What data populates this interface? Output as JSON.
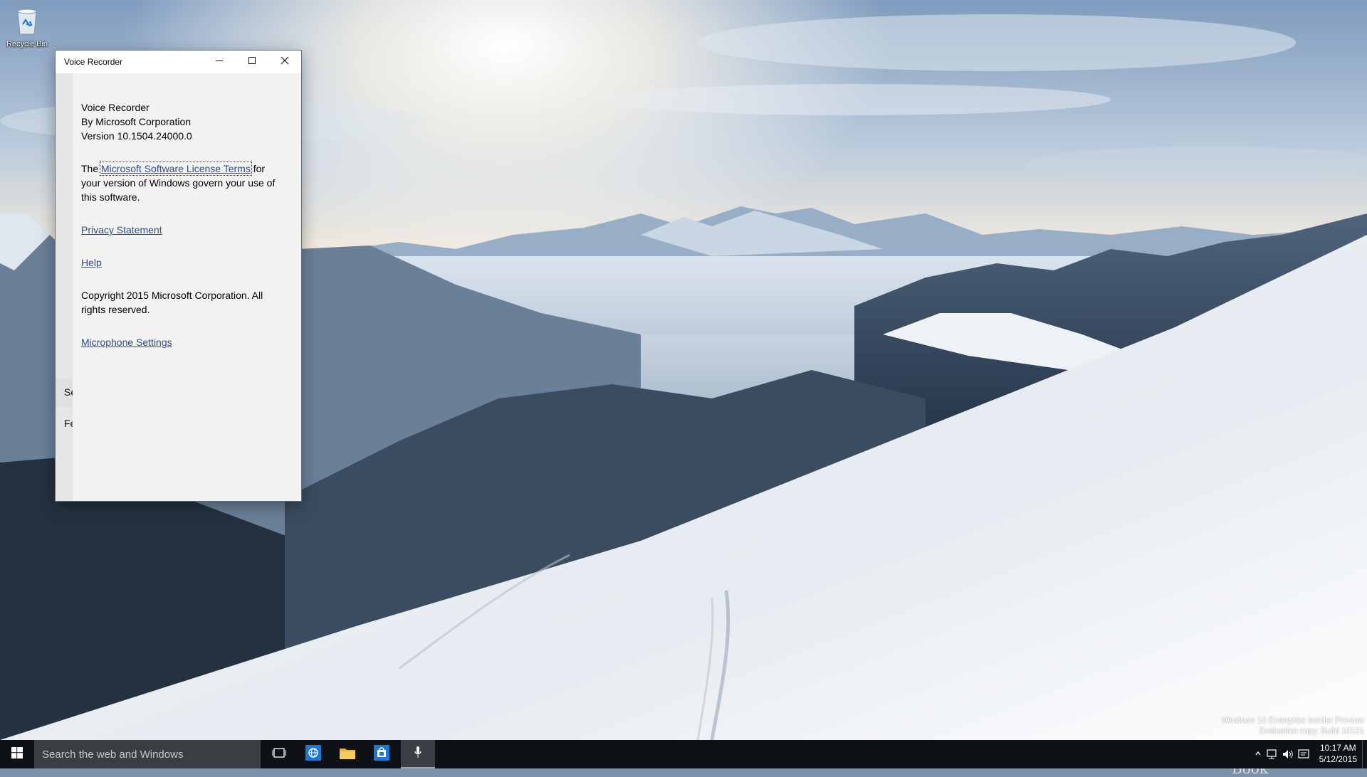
{
  "desktop": {
    "icons": [
      {
        "label": "Recycle Bin",
        "icon": "recycle-bin-icon"
      }
    ],
    "watermark": {
      "line1": "Windows 10 Enterprise Insider Preview",
      "line2": "Evaluation copy. Build 10121"
    },
    "brand": "The Collection Book"
  },
  "window": {
    "title": "Voice Recorder",
    "controls": {
      "minimize": "minimize-icon",
      "maximize": "maximize-icon",
      "close": "close-icon"
    },
    "rail": {
      "item1_stub": "Se",
      "item2_stub": "Fe"
    },
    "about": {
      "app_name": "Voice Recorder",
      "publisher": "By Microsoft Corporation",
      "version": "Version 10.1504.24000.0",
      "license_prefix": "The",
      "license_link": "Microsoft Software License Terms",
      "license_suffix": "for your version of Windows govern your use of this software.",
      "privacy_link": "Privacy Statement",
      "help_link": "Help",
      "copyright": "Copyright 2015 Microsoft Corporation. All rights reserved.",
      "microphone_link": "Microphone Settings"
    }
  },
  "taskbar": {
    "search_placeholder": "Search the web and Windows",
    "pinned": [
      {
        "name": "task-view",
        "icon": "task-view-icon"
      },
      {
        "name": "edge",
        "icon": "globe-icon"
      },
      {
        "name": "file-explorer",
        "icon": "folder-icon"
      },
      {
        "name": "store",
        "icon": "store-icon"
      },
      {
        "name": "voice-recorder",
        "icon": "microphone-icon",
        "active": true
      }
    ],
    "tray": {
      "icons": [
        "chevron-up-icon",
        "network-icon",
        "volume-icon",
        "action-center-icon"
      ],
      "time": "10:17 AM",
      "date": "5/12/2015"
    }
  },
  "colors": {
    "taskbar": "#0e1116",
    "search_box": "#3a3d42",
    "link": "#2b4e86",
    "pane": "#f2f2f2",
    "accent_blue": "#1e78d2"
  }
}
